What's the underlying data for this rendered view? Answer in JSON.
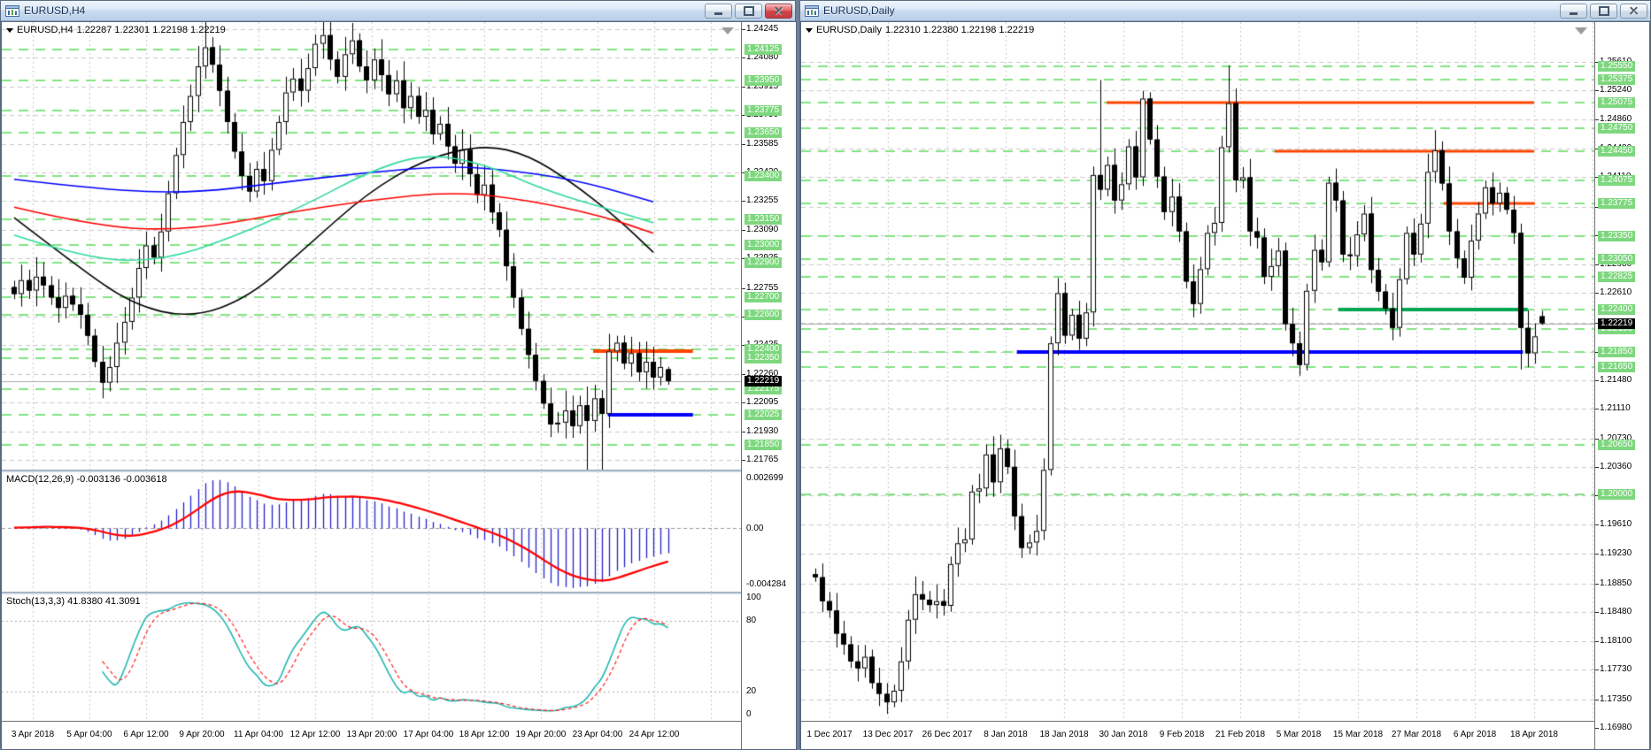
{
  "left_window": {
    "title": "EURUSD,H4",
    "quote": {
      "symbol": "EURUSD,H4",
      "ohlc": "1.22287 1.22301 1.22198 1.22219"
    },
    "macd": {
      "label": "MACD(12,26,9) -0.003136 -0.003618",
      "axis_top": "0.002699",
      "axis_zero": "0.00",
      "axis_bottom": "-0.004284"
    },
    "stoch": {
      "label": "Stoch(13,3,3) 41.8380 41.3091",
      "axis": [
        "100",
        "80",
        "20",
        "0"
      ]
    },
    "time_labels": [
      "3 Apr 2018",
      "5 Apr 04:00",
      "6 Apr 12:00",
      "9 Apr 20:00",
      "11 Apr 04:00",
      "12 Apr 12:00",
      "13 Apr 20:00",
      "17 Apr 04:00",
      "18 Apr 12:00",
      "19 Apr 20:00",
      "23 Apr 04:00",
      "24 Apr 12:00"
    ]
  },
  "right_window": {
    "title": "EURUSD,Daily",
    "quote": {
      "symbol": "EURUSD,Daily",
      "ohlc": "1.22310 1.22380 1.22198 1.22219"
    },
    "time_labels": [
      "1 Dec 2017",
      "13 Dec 2017",
      "26 Dec 2017",
      "8 Jan 2018",
      "18 Jan 2018",
      "30 Jan 2018",
      "9 Feb 2018",
      "21 Feb 2018",
      "5 Mar 2018",
      "15 Mar 2018",
      "27 Mar 2018",
      "6 Apr 2018",
      "18 Apr 2018"
    ]
  },
  "colors": {
    "grid": "#C9C9C9",
    "level_green": "#82E382",
    "label_green_bg": "#7ED77E",
    "orange": "#FF4500",
    "blue": "#0000FF",
    "green": "#00A651",
    "ma_black": "#000000",
    "ma_blue": "#0000FF",
    "ma_red": "#FF0000",
    "ma_green": "#2EDB9B",
    "macd_hist": "#2222CC",
    "macd_signal": "#FF0000",
    "stoch_main": "#1FB8B0",
    "stoch_signal": "#FF2020",
    "current_line": "#A8A8A8",
    "current_label_bg": "#000000"
  },
  "chart_data": [
    {
      "type": "candlestick",
      "symbol": "EURUSD",
      "timeframe": "H4",
      "current_price": 1.22219,
      "wick": 0.0011,
      "closes": [
        1.2272,
        1.228,
        1.2274,
        1.2282,
        1.2277,
        1.227,
        1.2264,
        1.2271,
        1.2266,
        1.226,
        1.2248,
        1.2233,
        1.2221,
        1.223,
        1.2244,
        1.2256,
        1.227,
        1.2287,
        1.23,
        1.2293,
        1.2308,
        1.233,
        1.2352,
        1.2371,
        1.2386,
        1.2403,
        1.2414,
        1.2404,
        1.2389,
        1.2371,
        1.2354,
        1.234,
        1.2331,
        1.2344,
        1.2337,
        1.2355,
        1.2371,
        1.2388,
        1.2396,
        1.2389,
        1.2402,
        1.2416,
        1.2421,
        1.2407,
        1.2397,
        1.241,
        1.2418,
        1.2403,
        1.2395,
        1.2407,
        1.2398,
        1.2387,
        1.2395,
        1.2379,
        1.2386,
        1.2374,
        1.2378,
        1.2364,
        1.237,
        1.2357,
        1.2347,
        1.2355,
        1.2341,
        1.2329,
        1.2335,
        1.2319,
        1.2309,
        1.2288,
        1.227,
        1.2252,
        1.2237,
        1.2222,
        1.2209,
        1.2197,
        1.2198,
        1.2205,
        1.2196,
        1.2208,
        1.2199,
        1.2212,
        1.2203,
        1.2239,
        1.2244,
        1.2232,
        1.2238,
        1.2227,
        1.2233,
        1.2224,
        1.223,
        1.22219
      ],
      "spikes": {
        "12": [
          null,
          1.2212
        ],
        "26": [
          1.243,
          null
        ],
        "42": [
          1.2436,
          null
        ],
        "46": [
          1.2428,
          null
        ],
        "78": [
          null,
          1.2157
        ],
        "80": [
          null,
          1.2162
        ],
        "82": [
          1.2248,
          null
        ],
        "89": [
          1.22301,
          1.22198,
          1.22287
        ]
      },
      "axis_regular": [
        1.24245,
        1.2408,
        1.23915,
        1.2375,
        1.23585,
        1.2342,
        1.23255,
        1.2309,
        1.22925,
        1.22755,
        1.2259,
        1.22425,
        1.2226,
        1.22095,
        1.2193,
        1.21765
      ],
      "levels_green": [
        1.24125,
        1.2395,
        1.23775,
        1.2365,
        1.234,
        1.2315,
        1.23,
        1.229,
        1.227,
        1.226,
        1.224,
        1.2235,
        1.22175,
        1.22025,
        1.2185
      ],
      "segments": [
        {
          "color": "orange",
          "price": 1.2239,
          "from": 0.8,
          "to": 0.935,
          "width": 4
        },
        {
          "color": "blue",
          "price": 1.22025,
          "from": 0.82,
          "to": 0.935,
          "width": 4
        }
      ],
      "ma_lines": [
        {
          "name": "ma-slow-black",
          "color": "ma_black",
          "width": 1.6,
          "points": [
            [
              0,
              1.2316
            ],
            [
              8,
              1.229
            ],
            [
              16,
              1.2266
            ],
            [
              24,
              1.2258
            ],
            [
              32,
              1.227
            ],
            [
              40,
              1.23
            ],
            [
              48,
              1.233
            ],
            [
              56,
              1.235
            ],
            [
              64,
              1.2358
            ],
            [
              70,
              1.2352
            ],
            [
              76,
              1.2336
            ],
            [
              82,
              1.2316
            ],
            [
              87,
              1.2296
            ]
          ]
        },
        {
          "name": "ma-blue",
          "color": "ma_blue",
          "width": 1.6,
          "points": [
            [
              0,
              1.2338
            ],
            [
              12,
              1.2332
            ],
            [
              24,
              1.233
            ],
            [
              36,
              1.2336
            ],
            [
              48,
              1.2342
            ],
            [
              60,
              1.2346
            ],
            [
              70,
              1.2342
            ],
            [
              78,
              1.2336
            ],
            [
              87,
              1.2325
            ]
          ]
        },
        {
          "name": "ma-green",
          "color": "ma_green",
          "width": 1.6,
          "points": [
            [
              0,
              1.2306
            ],
            [
              10,
              1.2292
            ],
            [
              20,
              1.2291
            ],
            [
              30,
              1.2305
            ],
            [
              40,
              1.2324
            ],
            [
              48,
              1.2342
            ],
            [
              56,
              1.2353
            ],
            [
              64,
              1.2347
            ],
            [
              72,
              1.2332
            ],
            [
              80,
              1.2322
            ],
            [
              87,
              1.2313
            ]
          ]
        },
        {
          "name": "ma-red",
          "color": "ma_red",
          "width": 1.6,
          "points": [
            [
              0,
              1.2322
            ],
            [
              12,
              1.231
            ],
            [
              24,
              1.2309
            ],
            [
              36,
              1.2318
            ],
            [
              48,
              1.2326
            ],
            [
              60,
              1.2331
            ],
            [
              70,
              1.2326
            ],
            [
              80,
              1.2317
            ],
            [
              87,
              1.2307
            ]
          ]
        }
      ],
      "indicators": {
        "macd": {
          "fast": 12,
          "slow": 26,
          "signal": 9,
          "value": -0.003136,
          "signal_value": -0.003618
        },
        "stoch": {
          "k": 13,
          "d": 3,
          "slowing": 3,
          "value": 41.838,
          "signal_value": 41.3091
        }
      }
    },
    {
      "type": "candlestick",
      "symbol": "EURUSD",
      "timeframe": "Daily",
      "current_price": 1.22219,
      "wick": 0.0022,
      "closes": [
        1.1893,
        1.1862,
        1.185,
        1.182,
        1.1806,
        1.1784,
        1.1775,
        1.179,
        1.1756,
        1.1742,
        1.1731,
        1.1746,
        1.1784,
        1.1838,
        1.1871,
        1.1864,
        1.1857,
        1.1862,
        1.1856,
        1.191,
        1.1937,
        1.1942,
        1.2004,
        1.2008,
        1.2052,
        1.2016,
        1.206,
        1.2036,
        1.1972,
        1.1931,
        1.1938,
        1.1953,
        1.2032,
        1.2196,
        1.2261,
        1.2206,
        1.2233,
        1.2202,
        1.2236,
        1.2414,
        1.2395,
        1.2427,
        1.2381,
        1.2402,
        1.2451,
        1.2411,
        1.2513,
        1.246,
        1.2412,
        1.2366,
        1.2386,
        1.2341,
        1.2276,
        1.2247,
        1.2292,
        1.2339,
        1.2352,
        1.245,
        1.2507,
        1.2407,
        1.2411,
        1.2341,
        1.2333,
        1.2282,
        1.2296,
        1.2316,
        1.2221,
        1.2196,
        1.2168,
        1.2264,
        1.2317,
        1.2301,
        1.2404,
        1.2381,
        1.2311,
        1.2309,
        1.2337,
        1.2364,
        1.2291,
        1.2263,
        1.2241,
        1.2216,
        1.2279,
        1.2339,
        1.2311,
        1.2351,
        1.2418,
        1.2446,
        1.2403,
        1.2341,
        1.2306,
        1.2281,
        1.2329,
        1.2364,
        1.2398,
        1.2377,
        1.2391,
        1.2369,
        1.2339,
        1.2216,
        1.2183,
        1.2205,
        1.22219
      ],
      "spikes": {
        "10": [
          null,
          1.1716
        ],
        "39": [
          1.2425,
          null
        ],
        "40": [
          1.2537,
          null
        ],
        "46": [
          1.2523,
          null
        ],
        "58": [
          1.2556,
          null
        ],
        "68": [
          null,
          1.2154
        ],
        "87": [
          1.2472,
          null
        ],
        "99": [
          null,
          1.2162
        ],
        "100": [
          null,
          1.2165
        ],
        "102": [
          1.2238,
          1.22198,
          1.2231
        ]
      },
      "axis_regular": [
        1.2561,
        1.2524,
        1.2486,
        1.2448,
        1.2411,
        1.2373,
        1.2336,
        1.2298,
        1.2261,
        1.2223,
        1.2185,
        1.2148,
        1.2111,
        1.2073,
        1.2036,
        1.1999,
        1.1961,
        1.1923,
        1.1885,
        1.1848,
        1.181,
        1.1773,
        1.1735,
        1.1698
      ],
      "levels_green": [
        1.2555,
        1.25375,
        1.25075,
        1.2475,
        1.2445,
        1.24075,
        1.23775,
        1.2335,
        1.2305,
        1.22825,
        1.224,
        1.2215,
        1.2185,
        1.2165,
        1.2065,
        1.2
      ],
      "segments": [
        {
          "color": "orange",
          "price": 1.25075,
          "from": 0.385,
          "to": 0.924,
          "width": 3
        },
        {
          "color": "orange",
          "price": 1.2445,
          "from": 0.597,
          "to": 0.924,
          "width": 3
        },
        {
          "color": "orange",
          "price": 1.23775,
          "from": 0.81,
          "to": 0.925,
          "width": 3
        },
        {
          "color": "green",
          "price": 1.224,
          "from": 0.677,
          "to": 0.916,
          "width": 4
        },
        {
          "color": "blue",
          "price": 1.2185,
          "from": 0.272,
          "to": 0.91,
          "width": 4
        }
      ],
      "ma_lines": [],
      "indicators": {}
    }
  ]
}
